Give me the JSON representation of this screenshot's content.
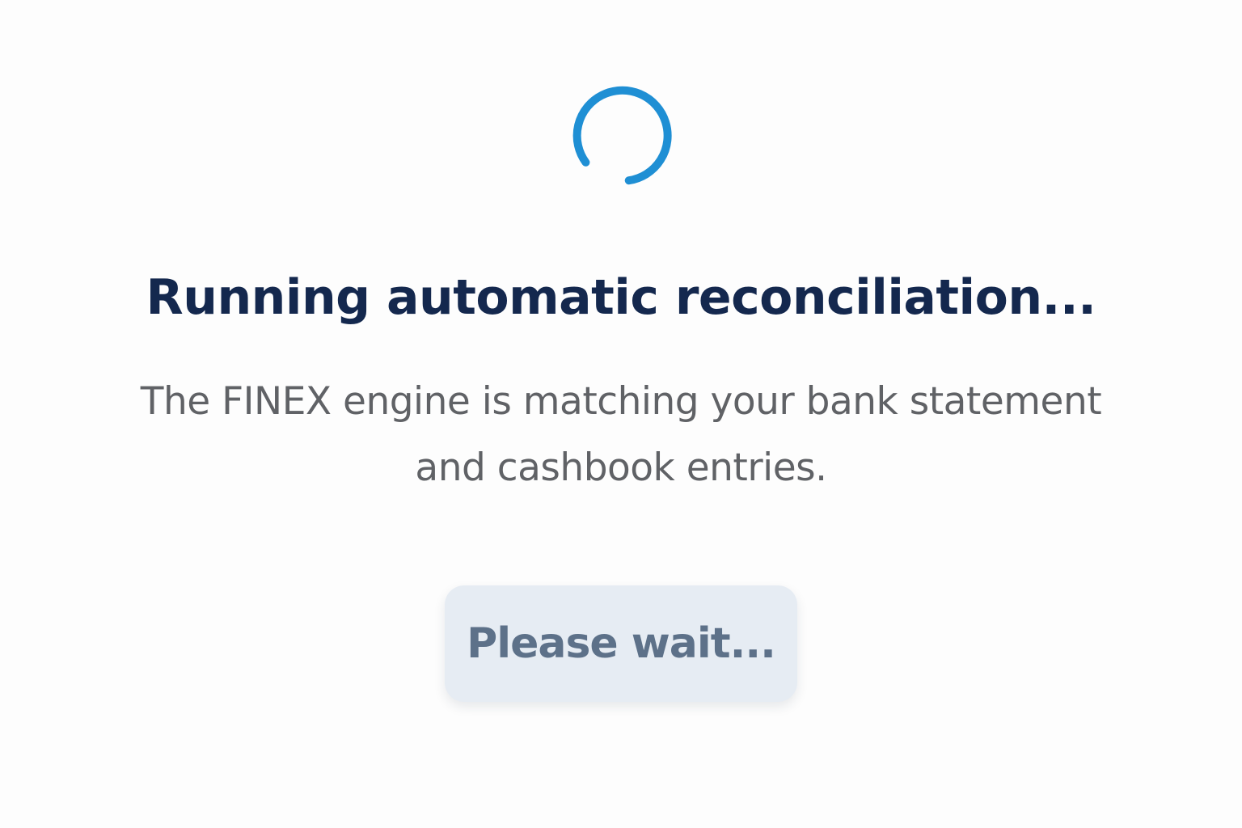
{
  "title": "Running automatic reconciliation...",
  "message": "The FINEX engine is matching your bank statement and cashbook entries.",
  "button": {
    "label": "Please wait...",
    "disabled": true
  },
  "spinner": {
    "icon": "loading-spinner-icon"
  },
  "colors": {
    "background": "#fdfdfd",
    "accent": "#1f8fd4",
    "title": "#14284e",
    "message": "#606266",
    "button_bg": "#e6ecf3",
    "button_text": "#5d7189"
  }
}
